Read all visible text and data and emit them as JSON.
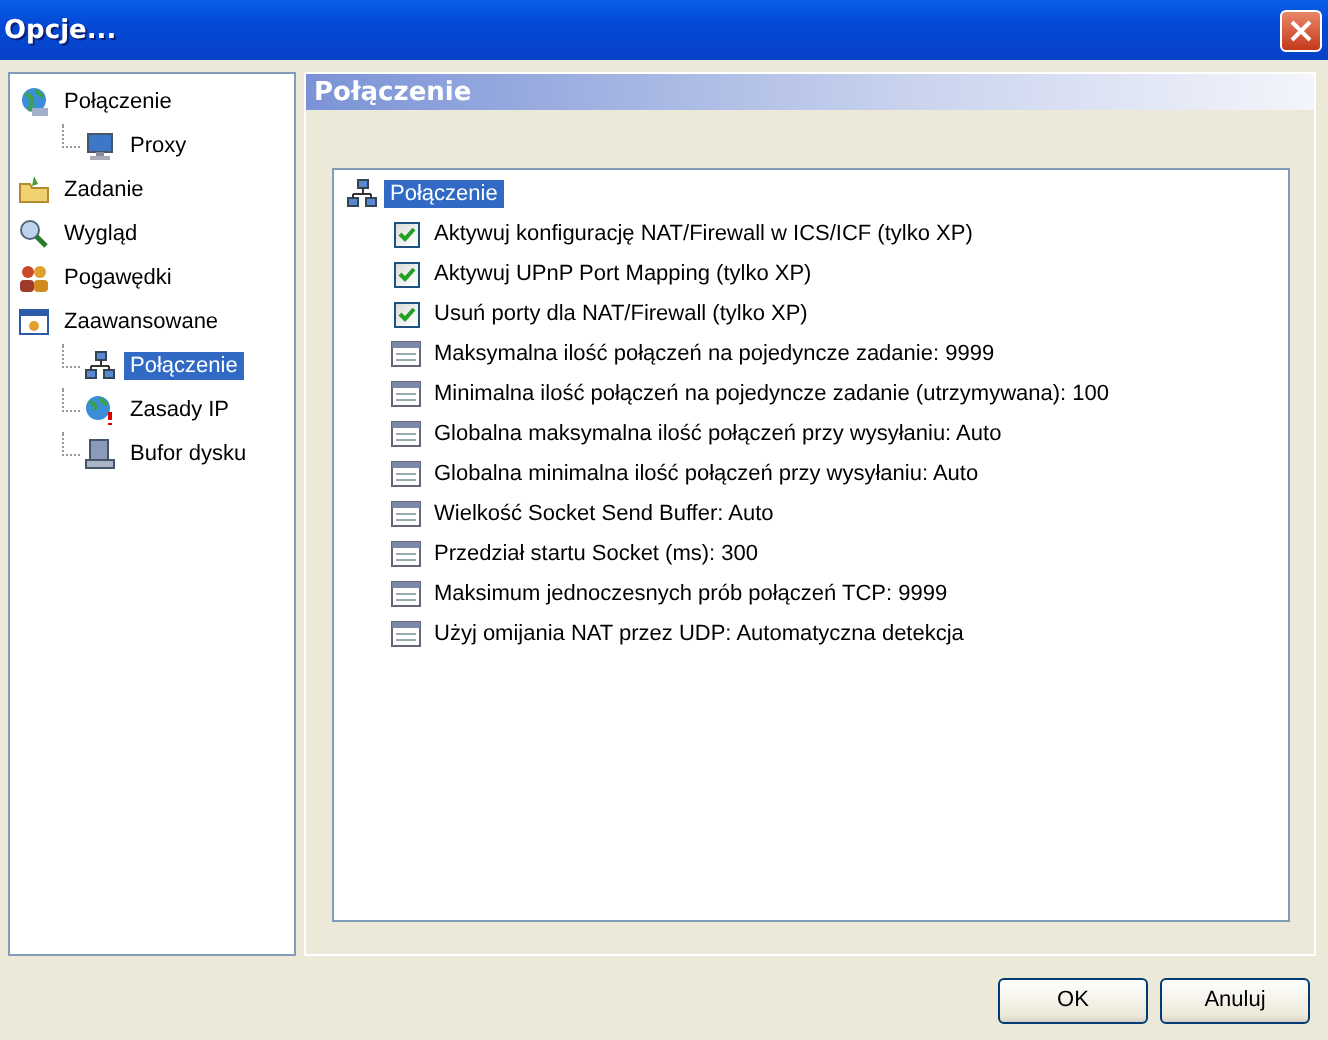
{
  "window": {
    "title": "Opcje..."
  },
  "sidebar": {
    "items": [
      {
        "label": "Połączenie",
        "selected": false,
        "children": [
          {
            "label": "Proxy",
            "selected": false
          }
        ]
      },
      {
        "label": "Zadanie",
        "selected": false
      },
      {
        "label": "Wygląd",
        "selected": false
      },
      {
        "label": "Pogawędki",
        "selected": false
      },
      {
        "label": "Zaawansowane",
        "selected": false,
        "children": [
          {
            "label": "Połączenie",
            "selected": true
          },
          {
            "label": "Zasady IP",
            "selected": false
          },
          {
            "label": "Bufor dysku",
            "selected": false
          }
        ]
      }
    ]
  },
  "panel": {
    "title": "Połączenie",
    "group": {
      "label": "Połączenie",
      "selected": true
    },
    "settings": [
      {
        "kind": "checkbox",
        "label": "Aktywuj konfigurację NAT/Firewall w ICS/ICF (tylko XP)",
        "checked": true
      },
      {
        "kind": "checkbox",
        "label": "Aktywuj UPnP Port Mapping (tylko XP)",
        "checked": true
      },
      {
        "kind": "checkbox",
        "label": "Usuń porty dla NAT/Firewall (tylko XP)",
        "checked": true
      },
      {
        "kind": "value",
        "label": "Maksymalna ilość połączeń na pojedyncze zadanie: 9999"
      },
      {
        "kind": "value",
        "label": "Minimalna ilość połączeń na pojedyncze zadanie (utrzymywana): 100"
      },
      {
        "kind": "value",
        "label": "Globalna maksymalna ilość połączeń przy wysyłaniu: Auto"
      },
      {
        "kind": "value",
        "label": "Globalna minimalna ilość połączeń przy wysyłaniu: Auto"
      },
      {
        "kind": "value",
        "label": "Wielkość Socket Send Buffer: Auto"
      },
      {
        "kind": "value",
        "label": "Przedział startu Socket (ms): 300"
      },
      {
        "kind": "value",
        "label": "Maksimum jednoczesnych prób połączeń TCP: 9999"
      },
      {
        "kind": "value",
        "label": "Użyj omijania NAT przez UDP: Automatyczna detekcja"
      }
    ]
  },
  "buttons": [
    "OK",
    "Anuluj"
  ]
}
